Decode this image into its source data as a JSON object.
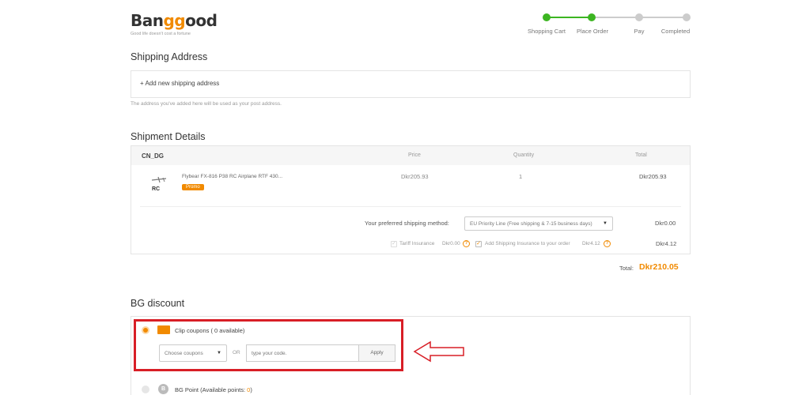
{
  "brand": {
    "logo_pre": "Ban",
    "logo_gg": "gg",
    "logo_post": "ood",
    "tagline": "Good life doesn't cost a fortune"
  },
  "steps": [
    "Shopping Cart",
    "Place Order",
    "Pay",
    "Completed"
  ],
  "shipping_address": {
    "title": "Shipping Address",
    "add_label": "+ Add new shipping address",
    "note": "The address you've added here will be used as your post address."
  },
  "shipment": {
    "title": "Shipment Details",
    "warehouse": "CN_DG",
    "headers": {
      "price": "Price",
      "quantity": "Quantity",
      "total": "Total"
    },
    "item": {
      "name": "Flybear FX-816 P38 RC Airplane RTF 430...",
      "badge": "Promo",
      "price": "Dkr205.93",
      "quantity": "1",
      "total": "Dkr205.93",
      "thumb_text": "RC"
    },
    "method_label": "Your preferred shipping method:",
    "method_value": "EU Priority Line (Free shipping & 7-15 business days)",
    "method_cost": "Dkr0.00",
    "tariff_label": "Tariff Insurance",
    "tariff_value": "Dkr0.00",
    "insurance_label": "Add Shipping Insurance to your order",
    "insurance_value": "Dkr4.12",
    "insurance_total": "Dkr4.12",
    "total_label": "Total:",
    "total_value": "Dkr210.05"
  },
  "discount": {
    "title": "BG discount",
    "clip_label": "Clip coupons ( 0 available)",
    "choose_label": "Choose coupons",
    "or_label": "OR",
    "code_placeholder": "type your code.",
    "apply_label": "Apply",
    "points_label": "BG Point (Available points:",
    "points_value": "0",
    "points_close": ")"
  },
  "colors": {
    "accent": "#f18a00",
    "progress_done": "#3cb521",
    "progress_todo": "#cccccc",
    "annotation": "#d81e26"
  }
}
